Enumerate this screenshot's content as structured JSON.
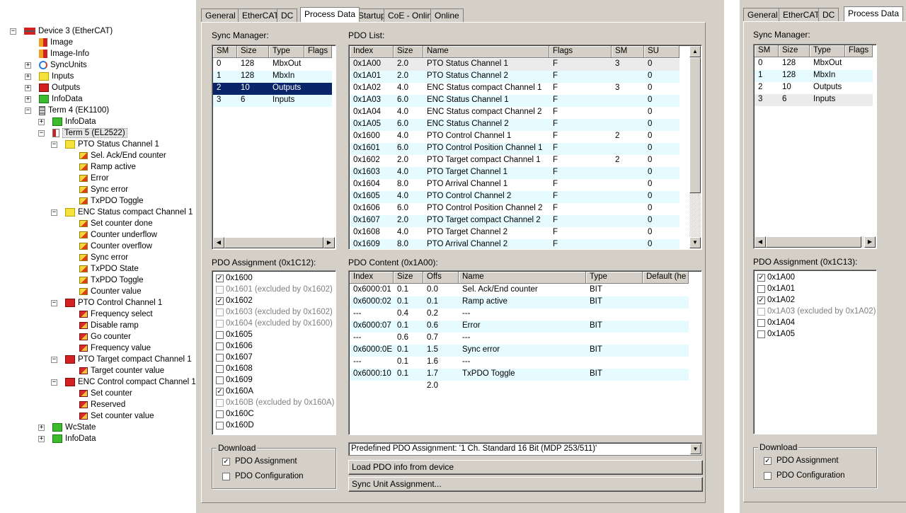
{
  "tree": [
    {
      "label": "Device 3 (EtherCAT)",
      "icon": "ethercat-icon",
      "exp": "−",
      "lvl": 0
    },
    {
      "label": "Image",
      "icon": "image-icon",
      "exp": "",
      "lvl": 1
    },
    {
      "label": "Image-Info",
      "icon": "image-icon",
      "exp": "",
      "lvl": 1
    },
    {
      "label": "SyncUnits",
      "icon": "sync-icon",
      "exp": "+",
      "lvl": 1
    },
    {
      "label": "Inputs",
      "icon": "yellow-io-icon",
      "exp": "+",
      "lvl": 1
    },
    {
      "label": "Outputs",
      "icon": "red-io-icon",
      "exp": "+",
      "lvl": 1
    },
    {
      "label": "InfoData",
      "icon": "green-io-icon",
      "exp": "+",
      "lvl": 1
    },
    {
      "label": "Term 4 (EK1100)",
      "icon": "coupler-icon",
      "exp": "−",
      "lvl": 1
    },
    {
      "label": "InfoData",
      "icon": "green-io-icon",
      "exp": "+",
      "lvl": 2
    },
    {
      "label": "Term 5 (EL2522)",
      "icon": "terminal-icon",
      "exp": "−",
      "lvl": 2,
      "selected": true
    },
    {
      "label": "PTO Status Channel 1",
      "icon": "yellow-io-icon",
      "exp": "−",
      "lvl": 3
    },
    {
      "label": "Sel. Ack/End counter",
      "icon": "input-var-icon",
      "exp": "",
      "lvl": 4
    },
    {
      "label": "Ramp active",
      "icon": "input-var-icon",
      "exp": "",
      "lvl": 4
    },
    {
      "label": "Error",
      "icon": "input-var-icon",
      "exp": "",
      "lvl": 4
    },
    {
      "label": "Sync error",
      "icon": "input-var-icon",
      "exp": "",
      "lvl": 4
    },
    {
      "label": "TxPDO Toggle",
      "icon": "input-var-icon",
      "exp": "",
      "lvl": 4
    },
    {
      "label": "ENC Status compact Channel 1",
      "icon": "yellow-io-icon",
      "exp": "−",
      "lvl": 3
    },
    {
      "label": "Set counter done",
      "icon": "input-var-icon",
      "exp": "",
      "lvl": 4
    },
    {
      "label": "Counter underflow",
      "icon": "input-var-icon",
      "exp": "",
      "lvl": 4
    },
    {
      "label": "Counter overflow",
      "icon": "input-var-icon",
      "exp": "",
      "lvl": 4
    },
    {
      "label": "Sync error",
      "icon": "input-var-icon",
      "exp": "",
      "lvl": 4
    },
    {
      "label": "TxPDO State",
      "icon": "input-var-icon",
      "exp": "",
      "lvl": 4
    },
    {
      "label": "TxPDO Toggle",
      "icon": "input-var-icon",
      "exp": "",
      "lvl": 4
    },
    {
      "label": "Counter value",
      "icon": "input-var-icon",
      "exp": "",
      "lvl": 4
    },
    {
      "label": "PTO Control Channel 1",
      "icon": "red-io-icon",
      "exp": "−",
      "lvl": 3
    },
    {
      "label": "Frequency select",
      "icon": "output-var-icon",
      "exp": "",
      "lvl": 4
    },
    {
      "label": "Disable ramp",
      "icon": "output-var-icon",
      "exp": "",
      "lvl": 4
    },
    {
      "label": "Go counter",
      "icon": "output-var-icon",
      "exp": "",
      "lvl": 4
    },
    {
      "label": "Frequency value",
      "icon": "output-var-icon",
      "exp": "",
      "lvl": 4
    },
    {
      "label": "PTO Target compact Channel 1",
      "icon": "red-io-icon",
      "exp": "−",
      "lvl": 3
    },
    {
      "label": "Target counter value",
      "icon": "output-var-icon",
      "exp": "",
      "lvl": 4
    },
    {
      "label": "ENC Control compact Channel 1",
      "icon": "red-io-icon",
      "exp": "−",
      "lvl": 3
    },
    {
      "label": "Set counter",
      "icon": "output-var-icon",
      "exp": "",
      "lvl": 4
    },
    {
      "label": "Reserved",
      "icon": "output-var-icon",
      "exp": "",
      "lvl": 4
    },
    {
      "label": "Set counter value",
      "icon": "output-var-icon",
      "exp": "",
      "lvl": 4
    },
    {
      "label": "WcState",
      "icon": "green-io-icon",
      "exp": "+",
      "lvl": 2
    },
    {
      "label": "InfoData",
      "icon": "green-io-icon",
      "exp": "+",
      "lvl": 2
    }
  ],
  "main": {
    "tabs": [
      "General",
      "EtherCAT",
      "DC",
      "Process Data",
      "Startup",
      "CoE - Online",
      "Online"
    ],
    "active_tab": 3,
    "sync_manager_label": "Sync Manager:",
    "sm_headers": [
      "SM",
      "Size",
      "Type",
      "Flags"
    ],
    "sm_rows": [
      [
        "0",
        "128",
        "MbxOut",
        ""
      ],
      [
        "1",
        "128",
        "MbxIn",
        ""
      ],
      [
        "2",
        "10",
        "Outputs",
        ""
      ],
      [
        "3",
        "6",
        "Inputs",
        ""
      ]
    ],
    "sm_selected": 2,
    "pdo_list_label": "PDO List:",
    "pdo_headers": [
      "Index",
      "Size",
      "Name",
      "Flags",
      "SM",
      "SU"
    ],
    "pdo_rows": [
      [
        "0x1A00",
        "2.0",
        "PTO Status Channel 1",
        "F",
        "3",
        "0"
      ],
      [
        "0x1A01",
        "2.0",
        "PTO Status Channel 2",
        "F",
        "",
        "0"
      ],
      [
        "0x1A02",
        "4.0",
        "ENC Status compact Channel 1",
        "F",
        "3",
        "0"
      ],
      [
        "0x1A03",
        "6.0",
        "ENC Status Channel 1",
        "F",
        "",
        "0"
      ],
      [
        "0x1A04",
        "4.0",
        "ENC Status compact Channel 2",
        "F",
        "",
        "0"
      ],
      [
        "0x1A05",
        "6.0",
        "ENC Status Channel 2",
        "F",
        "",
        "0"
      ],
      [
        "0x1600",
        "4.0",
        "PTO Control Channel 1",
        "F",
        "2",
        "0"
      ],
      [
        "0x1601",
        "6.0",
        "PTO Control Position Channel 1",
        "F",
        "",
        "0"
      ],
      [
        "0x1602",
        "2.0",
        "PTO Target compact Channel 1",
        "F",
        "2",
        "0"
      ],
      [
        "0x1603",
        "4.0",
        "PTO Target Channel 1",
        "F",
        "",
        "0"
      ],
      [
        "0x1604",
        "8.0",
        "PTO Arrival Channel 1",
        "F",
        "",
        "0"
      ],
      [
        "0x1605",
        "4.0",
        "PTO Control Channel 2",
        "F",
        "",
        "0"
      ],
      [
        "0x1606",
        "6.0",
        "PTO Control Position Channel 2",
        "F",
        "",
        "0"
      ],
      [
        "0x1607",
        "2.0",
        "PTO Target compact Channel 2",
        "F",
        "",
        "0"
      ],
      [
        "0x1608",
        "4.0",
        "PTO Target Channel 2",
        "F",
        "",
        "0"
      ],
      [
        "0x1609",
        "8.0",
        "PTO Arrival Channel 2",
        "F",
        "",
        "0"
      ]
    ],
    "pdo_assign_label": "PDO Assignment (0x1C12):",
    "pdo_assign": [
      {
        "t": "0x1600",
        "c": true,
        "d": false
      },
      {
        "t": "0x1601 (excluded by 0x1602)",
        "c": false,
        "d": true
      },
      {
        "t": "0x1602",
        "c": true,
        "d": false
      },
      {
        "t": "0x1603 (excluded by 0x1602)",
        "c": false,
        "d": true
      },
      {
        "t": "0x1604 (excluded by 0x1600)",
        "c": false,
        "d": true
      },
      {
        "t": "0x1605",
        "c": false,
        "d": false
      },
      {
        "t": "0x1606",
        "c": false,
        "d": false
      },
      {
        "t": "0x1607",
        "c": false,
        "d": false
      },
      {
        "t": "0x1608",
        "c": false,
        "d": false
      },
      {
        "t": "0x1609",
        "c": false,
        "d": false
      },
      {
        "t": "0x160A",
        "c": true,
        "d": false
      },
      {
        "t": "0x160B (excluded by 0x160A)",
        "c": false,
        "d": true
      },
      {
        "t": "0x160C",
        "c": false,
        "d": false
      },
      {
        "t": "0x160D",
        "c": false,
        "d": false
      }
    ],
    "pdo_content_label": "PDO Content (0x1A00):",
    "content_headers": [
      "Index",
      "Size",
      "Offs",
      "Name",
      "Type",
      "Default (he"
    ],
    "content_rows": [
      [
        "0x6000:01",
        "0.1",
        "0.0",
        "Sel. Ack/End counter",
        "BIT",
        ""
      ],
      [
        "0x6000:02",
        "0.1",
        "0.1",
        "Ramp active",
        "BIT",
        ""
      ],
      [
        "---",
        "0.4",
        "0.2",
        "---",
        "",
        ""
      ],
      [
        "0x6000:07",
        "0.1",
        "0.6",
        "Error",
        "BIT",
        ""
      ],
      [
        "---",
        "0.6",
        "0.7",
        "---",
        "",
        ""
      ],
      [
        "0x6000:0E",
        "0.1",
        "1.5",
        "Sync error",
        "BIT",
        ""
      ],
      [
        "---",
        "0.1",
        "1.6",
        "---",
        "",
        ""
      ],
      [
        "0x6000:10",
        "0.1",
        "1.7",
        "TxPDO Toggle",
        "BIT",
        ""
      ],
      [
        "",
        "",
        "2.0",
        "",
        "",
        ""
      ]
    ],
    "download_label": "Download",
    "chk_pdo_assignment": "PDO Assignment",
    "chk_pdo_configuration": "PDO Configuration",
    "predefined": "Predefined PDO Assignment: '1 Ch. Standard 16 Bit (MDP 253/511)'",
    "load_btn": "Load PDO info from device",
    "sync_btn": "Sync Unit Assignment..."
  },
  "right": {
    "tabs": [
      "General",
      "EtherCAT",
      "DC",
      "Process Data"
    ],
    "active_tab": 3,
    "sync_manager_label": "Sync Manager:",
    "sm_headers": [
      "SM",
      "Size",
      "Type",
      "Flags"
    ],
    "sm_rows": [
      [
        "0",
        "128",
        "MbxOut",
        ""
      ],
      [
        "1",
        "128",
        "MbxIn",
        ""
      ],
      [
        "2",
        "10",
        "Outputs",
        ""
      ],
      [
        "3",
        "6",
        "Inputs",
        ""
      ]
    ],
    "sm_selected": 3,
    "pdo_assign_label": "PDO Assignment (0x1C13):",
    "pdo_assign": [
      {
        "t": "0x1A00",
        "c": true,
        "d": false
      },
      {
        "t": "0x1A01",
        "c": false,
        "d": false
      },
      {
        "t": "0x1A02",
        "c": true,
        "d": false
      },
      {
        "t": "0x1A03 (excluded by 0x1A02)",
        "c": false,
        "d": true
      },
      {
        "t": "0x1A04",
        "c": false,
        "d": false
      },
      {
        "t": "0x1A05",
        "c": false,
        "d": false
      }
    ],
    "download_label": "Download",
    "chk_pdo_assignment": "PDO Assignment",
    "chk_pdo_configuration": "PDO Configuration"
  }
}
